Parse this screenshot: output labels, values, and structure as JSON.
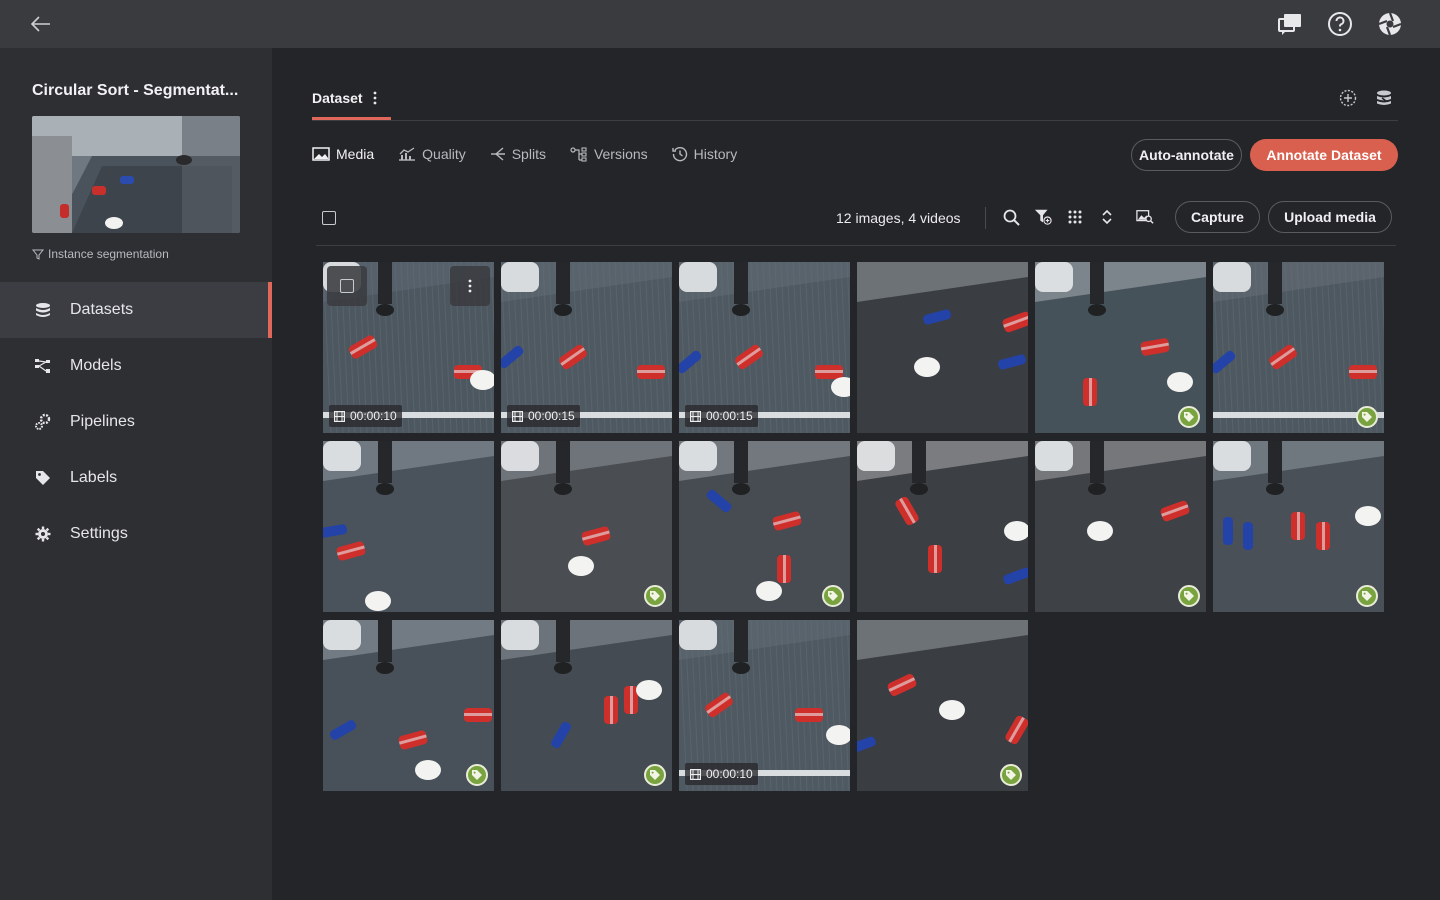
{
  "project": {
    "title": "Circular Sort - Segmentat...",
    "type": "Instance segmentation"
  },
  "nav": [
    {
      "label": "Datasets",
      "icon": "database-icon",
      "active": true
    },
    {
      "label": "Models",
      "icon": "models-icon",
      "active": false
    },
    {
      "label": "Pipelines",
      "icon": "pipelines-icon",
      "active": false
    },
    {
      "label": "Labels",
      "icon": "label-icon",
      "active": false
    },
    {
      "label": "Settings",
      "icon": "gear-icon",
      "active": false
    }
  ],
  "dataset": {
    "name": "Dataset"
  },
  "tabs": [
    {
      "label": "Media",
      "active": true
    },
    {
      "label": "Quality",
      "active": false
    },
    {
      "label": "Splits",
      "active": false
    },
    {
      "label": "Versions",
      "active": false
    },
    {
      "label": "History",
      "active": false
    }
  ],
  "actions": {
    "auto_annotate": "Auto-annotate",
    "annotate_dataset": "Annotate Dataset",
    "capture": "Capture",
    "upload_media": "Upload media"
  },
  "media_count": "12 images, 4 videos",
  "colors": {
    "accent": "#d9604f",
    "tag_green": "#79a33e"
  },
  "media": [
    {
      "duration": "00:00:10",
      "annotated": false,
      "video": true
    },
    {
      "duration": "00:00:15",
      "annotated": false,
      "video": true
    },
    {
      "duration": "00:00:15",
      "annotated": false,
      "video": true
    },
    {
      "duration": "",
      "annotated": false,
      "video": false
    },
    {
      "duration": "",
      "annotated": true,
      "video": false
    },
    {
      "duration": "",
      "annotated": true,
      "video": false
    },
    {
      "duration": "",
      "annotated": false,
      "video": false
    },
    {
      "duration": "",
      "annotated": true,
      "video": false
    },
    {
      "duration": "",
      "annotated": true,
      "video": false
    },
    {
      "duration": "",
      "annotated": false,
      "video": false
    },
    {
      "duration": "",
      "annotated": true,
      "video": false
    },
    {
      "duration": "",
      "annotated": true,
      "video": false
    },
    {
      "duration": "",
      "annotated": true,
      "video": false
    },
    {
      "duration": "",
      "annotated": true,
      "video": false
    },
    {
      "duration": "00:00:10",
      "annotated": false,
      "video": true
    },
    {
      "duration": "",
      "annotated": true,
      "video": false
    }
  ]
}
